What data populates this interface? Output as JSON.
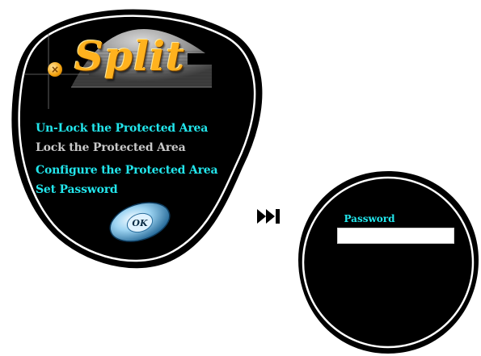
{
  "split_window": {
    "logo_text": "Split",
    "menu": [
      {
        "label": "Un-Lock the Protected Area",
        "state": "active"
      },
      {
        "label": "Lock the Protected Area",
        "state": "disabled"
      },
      {
        "label": "Configure the Protected Area",
        "state": "active"
      },
      {
        "label": "Set Password",
        "state": "active"
      }
    ],
    "ok_label": "OK",
    "close_icon": "close-icon"
  },
  "transition_icon": "skip-forward-icon",
  "password_window": {
    "label": "Password",
    "value": "",
    "placeholder": ""
  },
  "colors": {
    "menu_active": "#22e6ec",
    "menu_disabled": "#c8c8c8",
    "logo": "#ffb21e",
    "window_bg": "#000000"
  }
}
